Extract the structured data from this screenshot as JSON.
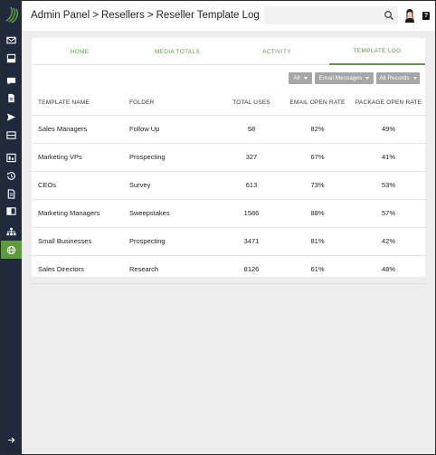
{
  "breadcrumb": {
    "items": [
      "Admin Panel",
      "Resellers",
      "Reseller Template Log"
    ],
    "separator": ">"
  },
  "search": {
    "placeholder": ""
  },
  "help_label": "?",
  "sidebar": {
    "icons": [
      "mail-icon",
      "inbox-icon",
      "chat-icon",
      "document-icon",
      "send-icon",
      "list-icon",
      "window-icon",
      "history-icon",
      "file-icon",
      "book-icon",
      "network-icon",
      "globe-icon"
    ],
    "active_index": 11,
    "collapse_icon": "arrow-right-icon"
  },
  "tabs": [
    "HOME",
    "MEDIA TOTALS",
    "ACTIVITY",
    "TEMPLATE LOG"
  ],
  "active_tab": 3,
  "filters": [
    "All",
    "Email Messages",
    "All Records"
  ],
  "table": {
    "columns": [
      "TEMPLATE NAME",
      "FOLDER",
      "TOTAL USES",
      "EMAIL OPEN RATE",
      "PACKAGE OPEN RATE"
    ],
    "rows": [
      [
        "Sales Managers",
        "Follow Up",
        "58",
        "82%",
        "49%"
      ],
      [
        "Marketing VPs",
        "Prospecting",
        "327",
        "67%",
        "41%"
      ],
      [
        "CEOs",
        "Survey",
        "613",
        "73%",
        "53%"
      ],
      [
        "Marketing Managers",
        "Sweepstakes",
        "1586",
        "88%",
        "57%"
      ],
      [
        "Small Businesses",
        "Prospecting",
        "3471",
        "81%",
        "42%"
      ],
      [
        "Sales Directors",
        "Research",
        "8126",
        "61%",
        "48%"
      ]
    ]
  },
  "colors": {
    "accent": "#5d9c3a",
    "sidebar": "#1f2b3d",
    "content_bg": "#ededed",
    "filter_bg": "#a6a6a6"
  }
}
